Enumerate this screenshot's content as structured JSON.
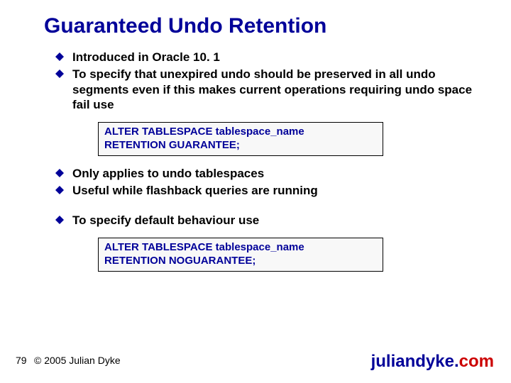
{
  "title": "Guaranteed Undo Retention",
  "bullets": {
    "b1": "Introduced in Oracle 10. 1",
    "b2": "To specify that unexpired undo should be preserved in all undo segments even if this makes current operations requiring undo space fail use",
    "b3": "Only applies to undo tablespaces",
    "b4": "Useful while flashback queries are running",
    "b5": "To specify default behaviour use"
  },
  "code": {
    "c1l1": "ALTER TABLESPACE tablespace_name",
    "c1l2": "RETENTION GUARANTEE;",
    "c2l1": "ALTER TABLESPACE tablespace_name",
    "c2l2": "RETENTION NOGUARANTEE;"
  },
  "footer": {
    "page": "79",
    "copyright": "© 2005 Julian Dyke",
    "site_a": "juliandyke.",
    "site_b": "com"
  }
}
